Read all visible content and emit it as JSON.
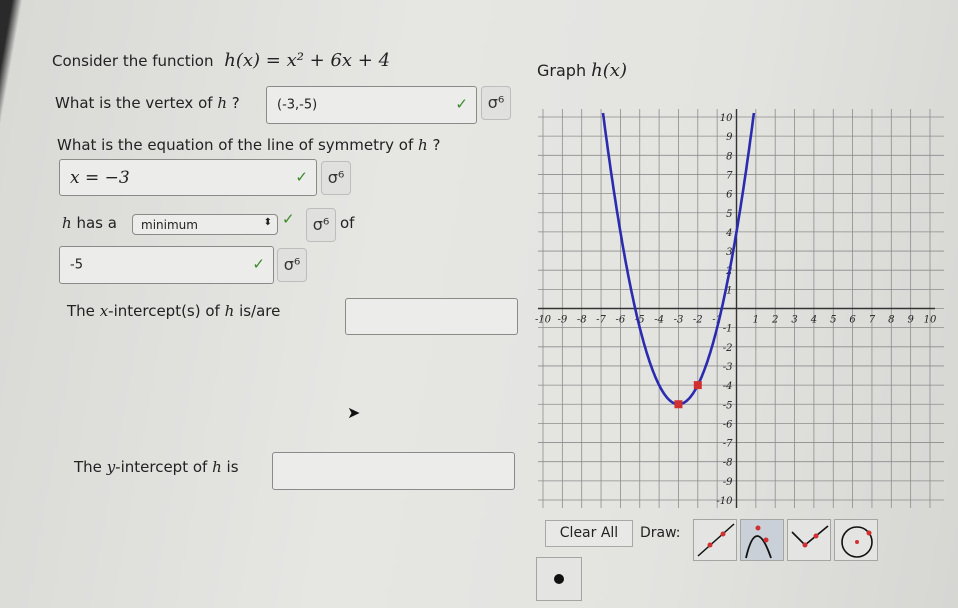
{
  "question": {
    "intro": "Consider the function",
    "function_expr": "h(x) = x² + 6x + 4",
    "vertex_q": {
      "label": "What is the vertex of",
      "var": "h",
      "suffix": "?",
      "value": "(-3,-5)"
    },
    "symmetry_q": {
      "label": "What is the equation of the line of symmetry of",
      "var": "h",
      "suffix": "?",
      "value": "x = −3"
    },
    "extremum_q": {
      "var": "h",
      "label": "has a",
      "selected": "minimum",
      "of": "of",
      "value": "-5"
    },
    "x_intercept_q": {
      "label_pre": "The",
      "var": "x",
      "label_mid": "-intercept(s) of",
      "func": "h",
      "label_post": "is/are",
      "value": ""
    },
    "y_intercept_q": {
      "label_pre": "The",
      "var": "y",
      "label_mid": "-intercept of",
      "func": "h",
      "label_post": "is",
      "value": ""
    }
  },
  "graph": {
    "title_pre": "Graph",
    "title_func": "h(x)",
    "curve_color": "#2b2bb0",
    "point_color": "#d03030",
    "chart_data": {
      "type": "line",
      "function": "x^2 + 6x + 4",
      "xlim": [
        -10,
        10
      ],
      "ylim": [
        -10,
        10
      ],
      "grid": true,
      "x_ticks": [
        "-10",
        "-9",
        "-8",
        "-7",
        "-6",
        "-5",
        "-4",
        "-3",
        "-2",
        "-1",
        "1",
        "2",
        "3",
        "4",
        "5",
        "6",
        "7",
        "8",
        "9",
        "10"
      ],
      "y_ticks": [
        "10",
        "9",
        "8",
        "7",
        "6",
        "5",
        "4",
        "3",
        "2",
        "1",
        "-1",
        "-2",
        "-3",
        "-4",
        "-5",
        "-6",
        "-7",
        "-8",
        "-9",
        "-10"
      ],
      "points": [
        {
          "x": -3,
          "y": -5
        },
        {
          "x": -2,
          "y": -4
        }
      ]
    }
  },
  "toolbar": {
    "clear_label": "Clear All",
    "draw_label": "Draw:",
    "tools": [
      "line-tool-icon",
      "parabola-tool-icon",
      "absolute-value-tool-icon",
      "circle-tool-icon",
      "point-tool-icon"
    ],
    "selected_tool": "parabola-tool-icon"
  }
}
